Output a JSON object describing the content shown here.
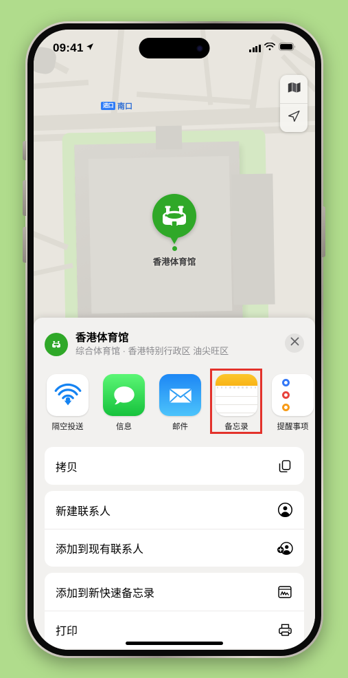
{
  "background_color": "#b0dc8c",
  "status_bar": {
    "time": "09:41",
    "location_icon": "location-arrow-icon",
    "cellular_icon": "cellular-bars-icon",
    "wifi_icon": "wifi-icon",
    "battery_icon": "battery-full-icon"
  },
  "map": {
    "labels": [
      {
        "badge": "进口",
        "text": "南口"
      }
    ],
    "pin": {
      "icon": "stadium-icon",
      "label": "香港体育馆",
      "color": "#2fa828"
    },
    "controls": [
      {
        "name": "map-type-button",
        "icon": "folded-map-icon"
      },
      {
        "name": "locate-me-button",
        "icon": "navigation-arrow-icon"
      }
    ]
  },
  "share_sheet": {
    "place": {
      "icon": "stadium-icon",
      "title": "香港体育馆",
      "subtitle": "综合体育馆 · 香港特别行政区 油尖旺区"
    },
    "close_label": "✕",
    "apps": [
      {
        "label": "隔空投送",
        "icon": "airdrop-icon",
        "highlighted": false
      },
      {
        "label": "信息",
        "icon": "messages-icon",
        "highlighted": false
      },
      {
        "label": "邮件",
        "icon": "mail-icon",
        "highlighted": false
      },
      {
        "label": "备忘录",
        "icon": "notes-icon",
        "highlighted": true
      },
      {
        "label": "提醒事项",
        "icon": "reminders-icon",
        "highlighted": false
      }
    ],
    "highlight_color": "#e3322b",
    "action_groups": [
      {
        "rows": [
          {
            "label": "拷贝",
            "icon": "copy-icon"
          }
        ]
      },
      {
        "rows": [
          {
            "label": "新建联系人",
            "icon": "person-circle-icon"
          },
          {
            "label": "添加到现有联系人",
            "icon": "person-badge-plus-icon"
          }
        ]
      },
      {
        "rows": [
          {
            "label": "添加到新快速备忘录",
            "icon": "quick-note-icon"
          },
          {
            "label": "打印",
            "icon": "printer-icon"
          }
        ]
      }
    ]
  }
}
